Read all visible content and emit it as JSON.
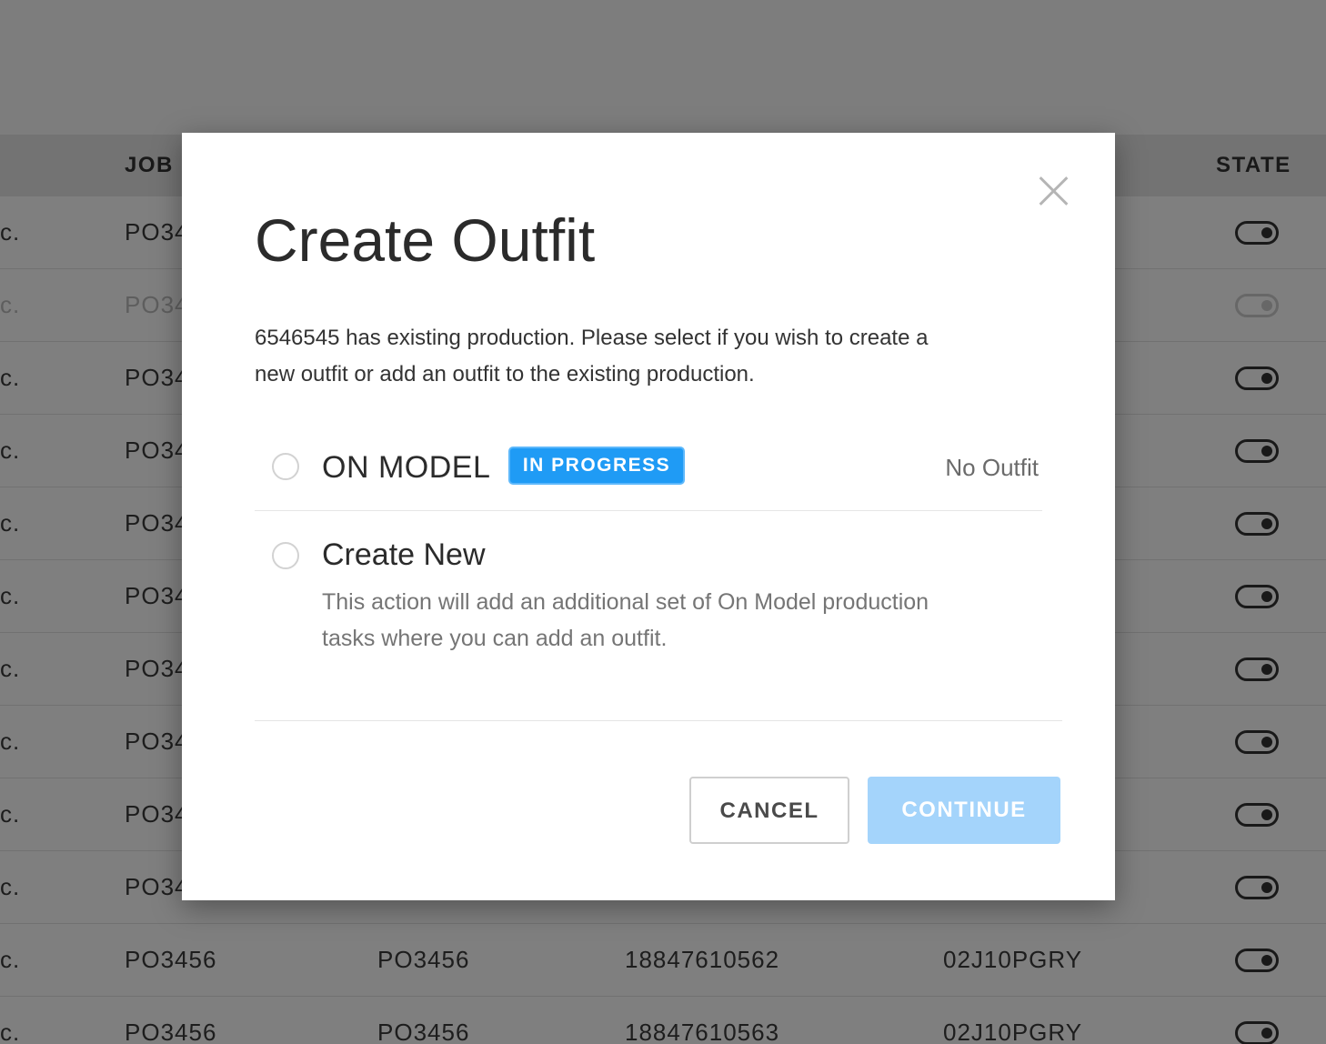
{
  "table": {
    "headers": {
      "job": "JOB",
      "state": "STATE"
    },
    "rows": [
      {
        "col1": "c.",
        "job": "PO34",
        "col3": "",
        "col4": "",
        "col5": "",
        "muted": false
      },
      {
        "col1": "c.",
        "job": "PO34",
        "col3": "",
        "col4": "",
        "col5": "",
        "muted": true
      },
      {
        "col1": "c.",
        "job": "PO34",
        "col3": "",
        "col4": "",
        "col5": "",
        "muted": false
      },
      {
        "col1": "c.",
        "job": "PO34",
        "col3": "",
        "col4": "",
        "col5": "",
        "muted": false
      },
      {
        "col1": "c.",
        "job": "PO34",
        "col3": "",
        "col4": "",
        "col5": "",
        "muted": false
      },
      {
        "col1": "c.",
        "job": "PO34",
        "col3": "",
        "col4": "",
        "col5": "",
        "muted": false
      },
      {
        "col1": "c.",
        "job": "PO34",
        "col3": "",
        "col4": "",
        "col5": "",
        "muted": false
      },
      {
        "col1": "c.",
        "job": "PO34",
        "col3": "",
        "col4": "",
        "col5": "",
        "muted": false
      },
      {
        "col1": "c.",
        "job": "PO34",
        "col3": "",
        "col4": "",
        "col5": "",
        "muted": false
      },
      {
        "col1": "c.",
        "job": "PO34",
        "col3": "",
        "col4": "",
        "col5": "",
        "muted": false
      },
      {
        "col1": "c.",
        "job": "PO3456",
        "col3": "PO3456",
        "col4": "18847610562",
        "col5": "02J10PGRY",
        "muted": false
      },
      {
        "col1": "c.",
        "job": "PO3456",
        "col3": "PO3456",
        "col4": "18847610563",
        "col5": "02J10PGRY",
        "muted": false
      }
    ]
  },
  "modal": {
    "title": "Create Outfit",
    "description": "6546545 has existing production. Please select if you wish to create a new outfit or add an outfit to the existing production.",
    "options": [
      {
        "label": "ON MODEL",
        "badge": "IN PROGRESS",
        "status": "No Outfit"
      },
      {
        "label": "Create New",
        "description": "This action will add an additional set of On Model production tasks where you can add an outfit."
      }
    ],
    "cancel_label": "CANCEL",
    "continue_label": "CONTINUE"
  },
  "colors": {
    "accent": "#1f9bf5",
    "continue_disabled": "#a4d4fb"
  }
}
